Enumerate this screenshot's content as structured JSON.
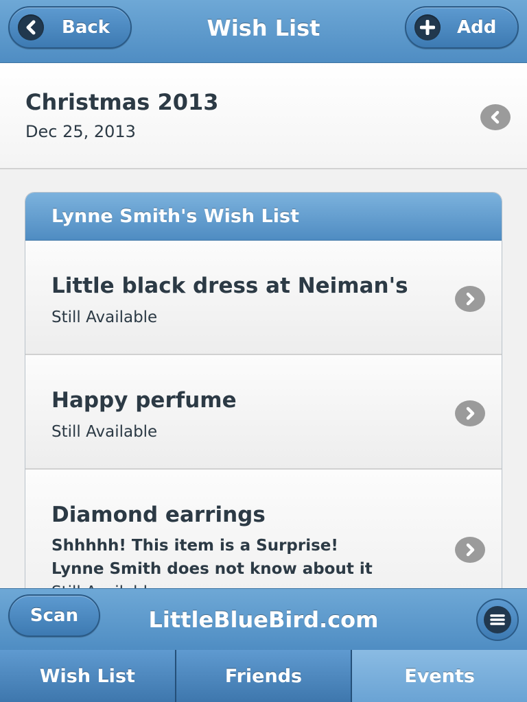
{
  "header": {
    "back_label": "Back",
    "title": "Wish List",
    "add_label": "Add"
  },
  "event": {
    "title": "Christmas 2013",
    "date": "Dec 25, 2013"
  },
  "list": {
    "heading": "Lynne Smith's Wish List",
    "items": [
      {
        "title": "Little black dress at Neiman's",
        "status": "Still Available"
      },
      {
        "title": "Happy perfume",
        "status": "Still Available"
      },
      {
        "title": "Diamond earrings",
        "note_line1": "Shhhhh! This item is a Surprise!",
        "note_line2": "Lynne Smith does not know about it",
        "status": "Still Available"
      }
    ]
  },
  "footer": {
    "scan_label": "Scan",
    "site_name": "LittleBlueBird.com"
  },
  "tabs": [
    {
      "label": "Wish List",
      "active": false
    },
    {
      "label": "Friends",
      "active": false
    },
    {
      "label": "Events",
      "active": true
    }
  ],
  "colors": {
    "bar_blue": "#5b99cf",
    "active_tab": "#7ab1dd",
    "text_dark": "#2c3a45",
    "chevron_grey": "#9b9b9b"
  }
}
